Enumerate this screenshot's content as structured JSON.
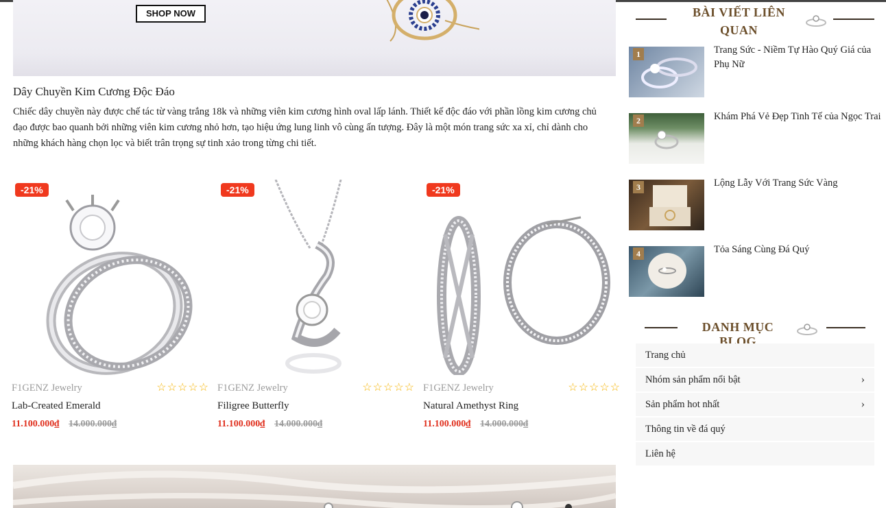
{
  "banner": {
    "shop_now": "SHOP NOW"
  },
  "article": {
    "title": "Dây Chuyền Kim Cương Độc Đáo",
    "body": "Chiếc dây chuyền này được chế tác từ vàng trắng 18k và những viên kim cương hình oval lấp lánh. Thiết kế độc đáo với phần lồng kim cương chủ đạo được bao quanh bởi những viên kim cương nhỏ hơn, tạo hiệu ứng lung linh vô cùng ấn tượng. Đây là một món trang sức xa xỉ, chỉ dành cho những khách hàng chọn lọc và biết trân trọng sự tinh xảo trong từng chi tiết."
  },
  "products": [
    {
      "discount": "-21%",
      "brand": "F1GENZ Jewelry",
      "stars": "☆☆☆☆☆",
      "name": "Lab-Created Emerald",
      "price": "11.100.000₫",
      "old_price": "14.000.000₫",
      "icon": "ring-set-icon"
    },
    {
      "discount": "-21%",
      "brand": "F1GENZ Jewelry",
      "stars": "☆☆☆☆☆",
      "name": "Filigree Butterfly",
      "price": "11.100.000₫",
      "old_price": "14.000.000₫",
      "icon": "pendant-necklace-icon"
    },
    {
      "discount": "-21%",
      "brand": "F1GENZ Jewelry",
      "stars": "☆☆☆☆☆",
      "name": "Natural Amethyst Ring",
      "price": "11.100.000₫",
      "old_price": "14.000.000₫",
      "icon": "hoop-earrings-icon"
    }
  ],
  "sidebar": {
    "related_title_line1": "BÀI VIẾT LIÊN",
    "related_title_line2": "QUAN",
    "posts": [
      {
        "num": "1",
        "title": "Trang Sức - Niềm Tự Hào Quý Giá của Phụ Nữ"
      },
      {
        "num": "2",
        "title": "Khám Phá Vẻ Đẹp Tinh Tế của Ngọc Trai"
      },
      {
        "num": "3",
        "title": "Lộng Lẫy Với Trang Sức Vàng"
      },
      {
        "num": "4",
        "title": "Tỏa Sáng Cùng Đá Quý"
      }
    ],
    "category_title": "DANH MỤC BLOG",
    "menu": [
      {
        "label": "Trang chủ",
        "has_sub": false
      },
      {
        "label": "Nhóm sản phẩm nổi bật",
        "has_sub": true,
        "arrow": "›"
      },
      {
        "label": "Sản phẩm hot nhất",
        "has_sub": true,
        "arrow": "›"
      },
      {
        "label": "Thông tin về đá quý",
        "has_sub": false
      },
      {
        "label": "Liên hệ",
        "has_sub": false
      }
    ]
  },
  "colors": {
    "accent_red": "#f0391e",
    "price_red": "#e0301e",
    "gold": "#a17d4d",
    "star": "#f5b301"
  }
}
